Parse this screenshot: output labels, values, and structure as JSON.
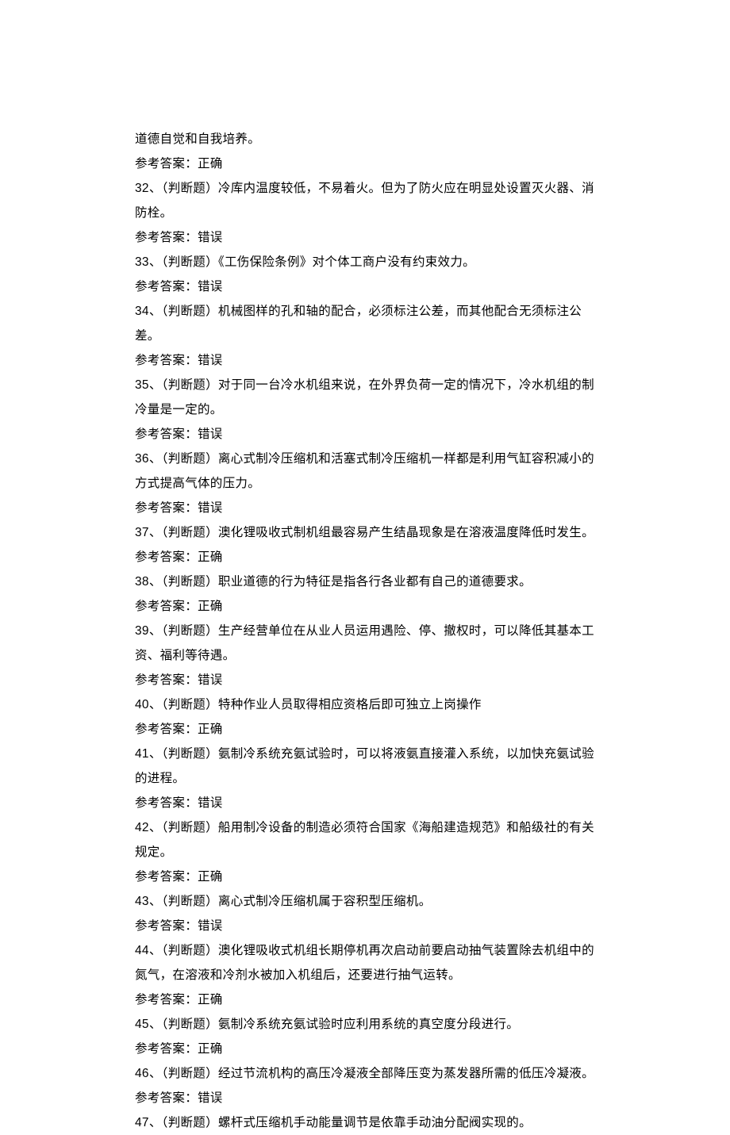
{
  "lines": [
    "道德自觉和自我培养。",
    "参考答案：正确",
    "32、（判断题）冷库内温度较低，不易着火。但为了防火应在明显处设置灭火器、消防栓。",
    "参考答案：错误",
    "33、（判断题）《工伤保险条例》对个体工商户没有约束效力。",
    "参考答案：错误",
    "34、（判断题）机械图样的孔和轴的配合，必须标注公差，而其他配合无须标注公差。",
    "参考答案：错误",
    "35、（判断题）对于同一台冷水机组来说，在外界负荷一定的情况下，冷水机组的制冷量是一定的。",
    "参考答案：错误",
    "36、（判断题）离心式制冷压缩机和活塞式制冷压缩机一样都是利用气缸容积减小的方式提高气体的压力。",
    "参考答案：错误",
    "37、（判断题）澳化锂吸收式制机组最容易产生结晶现象是在溶液温度降低时发生。",
    "参考答案：正确",
    "38、（判断题）职业道德的行为特征是指各行各业都有自己的道德要求。",
    "参考答案：正确",
    "39、（判断题）生产经营单位在从业人员运用遇险、停、撤权时，可以降低其基本工资、福利等待遇。",
    "参考答案：错误",
    "40、（判断题）特种作业人员取得相应资格后即可独立上岗操作",
    "参考答案：正确",
    "41、（判断题）氨制冷系统充氨试验时，可以将液氨直接灌入系统，以加快充氨试验的进程。",
    "参考答案：错误",
    "42、（判断题）船用制冷设备的制造必须符合国家《海船建造规范》和船级社的有关规定。",
    "参考答案：正确",
    "43、（判断题）离心式制冷压缩机属于容积型压缩机。",
    "参考答案：错误",
    "44、（判断题）澳化锂吸收式机组长期停机再次启动前要启动抽气装置除去机组中的氮气，在溶液和冷剂水被加入机组后，还要进行抽气运转。",
    "参考答案：正确",
    "45、（判断题）氨制冷系统充氨试验时应利用系统的真空度分段进行。",
    "参考答案：正确",
    "46、（判断题）经过节流机构的高压冷凝液全部降压变为蒸发器所需的低压冷凝液。",
    "参考答案：错误",
    "47、（判断题）螺杆式压缩机手动能量调节是依靠手动油分配阀实现的。"
  ]
}
